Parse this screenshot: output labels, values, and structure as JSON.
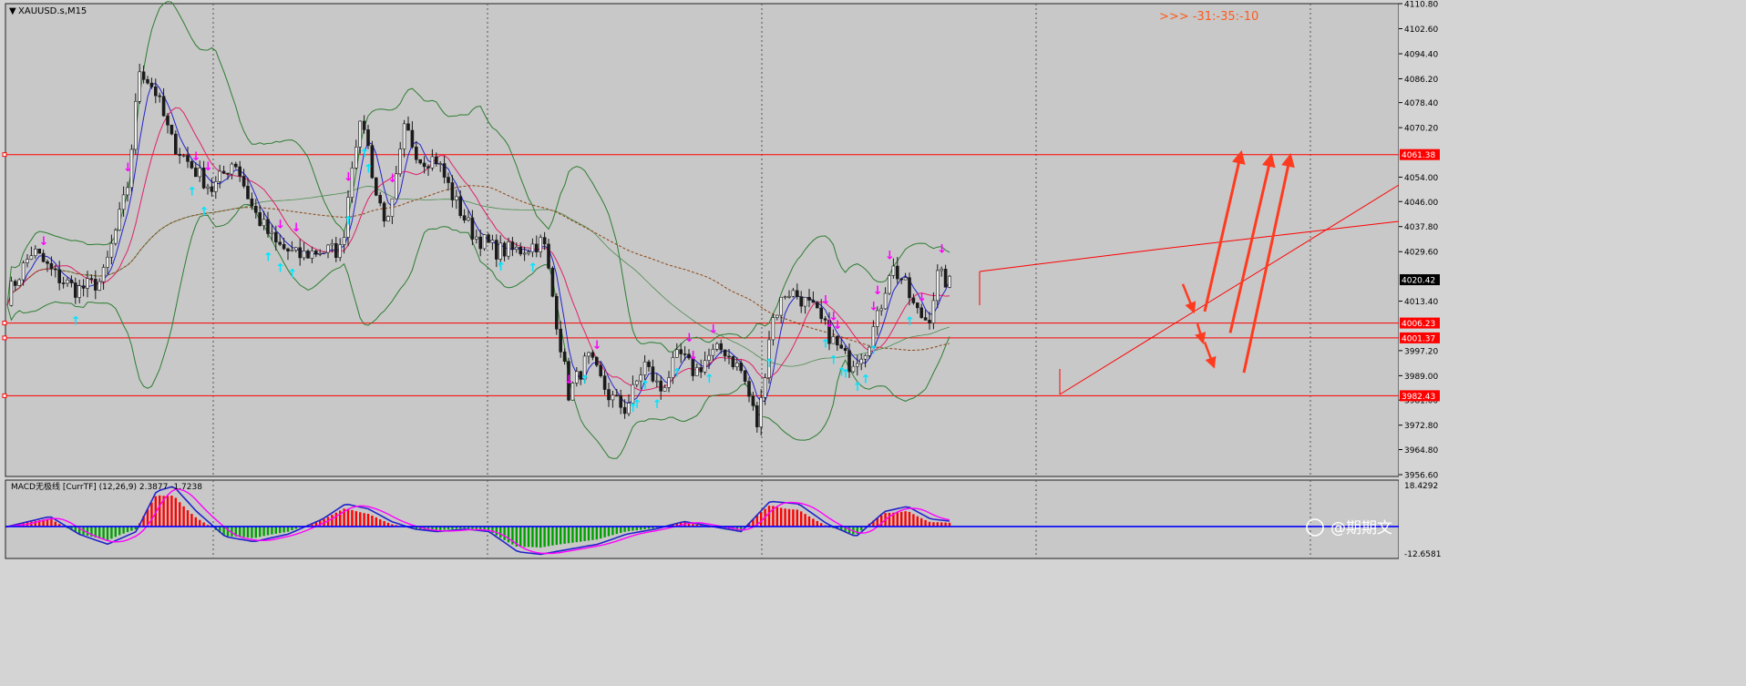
{
  "window": {
    "symbol_label": "XAUUSD.s,M15",
    "signal_text": ">>> -31:-35:-10",
    "watermark": "@期期文"
  },
  "colors": {
    "background": "#c8c8c8",
    "grid": "#555555",
    "candle_fill": "#1a1a1a",
    "bollinger": "#2e7d32",
    "ma_fast": "#2222cc",
    "ma_mid": "#e0206a",
    "ma_long_dashed": "#8b4513",
    "support_resistance": "#ff0000",
    "arrow_up": "#00e5ff",
    "arrow_down": "#ff00ff",
    "projection": "#ff3b1f",
    "macd_histogram_positive": "#ff0000",
    "macd_histogram_negative": "#00a000",
    "macd_zero_line": "#0000ff"
  },
  "chart_data": [
    {
      "type": "line",
      "name_shown": "XAUUSD.s,M15",
      "ylim": [
        3956.0,
        4110.8
      ],
      "price_axis_ticks": [
        "4110.80",
        "4102.60",
        "4094.40",
        "4086.20",
        "4078.40",
        "4070.20",
        "4054.00",
        "4046.00",
        "4037.80",
        "4029.60",
        "4013.40",
        "3997.20",
        "3989.00",
        "3981.00",
        "3972.80",
        "3964.80",
        "3956.60"
      ],
      "horizontal_levels": [
        {
          "price": 4061.38,
          "label": "4061.38"
        },
        {
          "price": 4006.23,
          "label": "4006.23"
        },
        {
          "price": 4001.37,
          "label": "4001.37"
        },
        {
          "price": 3982.43,
          "label": "3982.43"
        }
      ],
      "current_price": {
        "price": 4020.42,
        "label": "4020.42"
      },
      "bars_count": 236,
      "close_anchors": [
        [
          0,
          4015
        ],
        [
          8,
          4030
        ],
        [
          15,
          4022
        ],
        [
          22,
          4017
        ],
        [
          30,
          4020
        ],
        [
          38,
          4050
        ],
        [
          42,
          4090
        ],
        [
          47,
          4082
        ],
        [
          52,
          4066
        ],
        [
          58,
          4058
        ],
        [
          65,
          4050
        ],
        [
          72,
          4060
        ],
        [
          78,
          4043
        ],
        [
          85,
          4032
        ],
        [
          92,
          4028
        ],
        [
          99,
          4030
        ],
        [
          106,
          4030
        ],
        [
          110,
          4065
        ],
        [
          113,
          4072
        ],
        [
          117,
          4048
        ],
        [
          121,
          4038
        ],
        [
          126,
          4070
        ],
        [
          131,
          4060
        ],
        [
          136,
          4060
        ],
        [
          142,
          4046
        ],
        [
          148,
          4035
        ],
        [
          155,
          4030
        ],
        [
          162,
          4030
        ],
        [
          170,
          4033
        ],
        [
          178,
          3983
        ],
        [
          184,
          3995
        ],
        [
          191,
          3982
        ],
        [
          196,
          3978
        ],
        [
          202,
          3993
        ],
        [
          207,
          3984
        ],
        [
          213,
          3996
        ],
        [
          218,
          3990
        ],
        [
          222,
          3995
        ],
        [
          227,
          3998
        ],
        [
          233,
          3990
        ],
        [
          238,
          3972
        ],
        [
          242,
          4006
        ],
        [
          247,
          4017
        ],
        [
          251,
          4015
        ],
        [
          256,
          4010
        ],
        [
          262,
          4000
        ],
        [
          267,
          3993
        ],
        [
          272,
          3998
        ],
        [
          276,
          4008
        ],
        [
          280,
          4025
        ],
        [
          284,
          4020
        ],
        [
          288,
          4010
        ],
        [
          292,
          4007
        ],
        [
          295,
          4022
        ],
        [
          300,
          4018
        ]
      ],
      "down_arrow_bars": [
        12,
        38,
        60,
        64,
        86,
        92,
        108,
        122,
        178,
        187,
        216,
        217,
        224,
        259,
        260,
        262,
        263,
        275,
        276,
        280,
        290,
        296,
        302,
        305,
        308
      ],
      "up_arrow_bars": [
        22,
        58,
        62,
        82,
        86,
        90,
        108,
        113,
        114,
        156,
        166,
        183,
        198,
        200,
        202,
        206,
        212,
        222,
        242,
        259,
        262,
        264,
        266,
        270,
        272,
        274,
        286
      ],
      "projection_arrows": [
        {
          "from_price": 4010,
          "to_price": 4062,
          "kind": "up"
        },
        {
          "from_price": 4003,
          "to_price": 4061,
          "kind": "up"
        },
        {
          "from_price": 3990,
          "to_price": 4061,
          "kind": "up"
        },
        {
          "from_price": 4019,
          "to_price": 4010,
          "kind": "down"
        },
        {
          "from_price": 4006,
          "to_price": 4000,
          "kind": "down"
        },
        {
          "from_price": 4000,
          "to_price": 3992,
          "kind": "down"
        }
      ]
    },
    {
      "type": "bar",
      "indicator_label": "MACD无极线 [CurrTF] (12,26,9) 2.3877 -1.7238",
      "ylim": [
        -12.6581,
        18.4292
      ],
      "axis_ticks": [
        "18.4292",
        "-12.6581"
      ],
      "macd_anchors": [
        [
          0,
          0
        ],
        [
          15,
          4
        ],
        [
          25,
          -3
        ],
        [
          35,
          -7
        ],
        [
          45,
          -2
        ],
        [
          52,
          14
        ],
        [
          58,
          16
        ],
        [
          66,
          6
        ],
        [
          76,
          -4
        ],
        [
          86,
          -6
        ],
        [
          98,
          -3
        ],
        [
          110,
          3
        ],
        [
          118,
          9
        ],
        [
          126,
          7
        ],
        [
          134,
          2
        ],
        [
          142,
          -1
        ],
        [
          150,
          -2
        ],
        [
          160,
          -1
        ],
        [
          168,
          -2
        ],
        [
          178,
          -10
        ],
        [
          186,
          -11
        ],
        [
          196,
          -9
        ],
        [
          206,
          -7
        ],
        [
          216,
          -3
        ],
        [
          226,
          -1
        ],
        [
          236,
          2
        ],
        [
          246,
          0
        ],
        [
          256,
          -2
        ],
        [
          266,
          10
        ],
        [
          276,
          9
        ],
        [
          286,
          1
        ],
        [
          296,
          -4
        ],
        [
          306,
          6
        ],
        [
          314,
          8
        ],
        [
          322,
          3
        ],
        [
          330,
          2
        ]
      ]
    }
  ]
}
